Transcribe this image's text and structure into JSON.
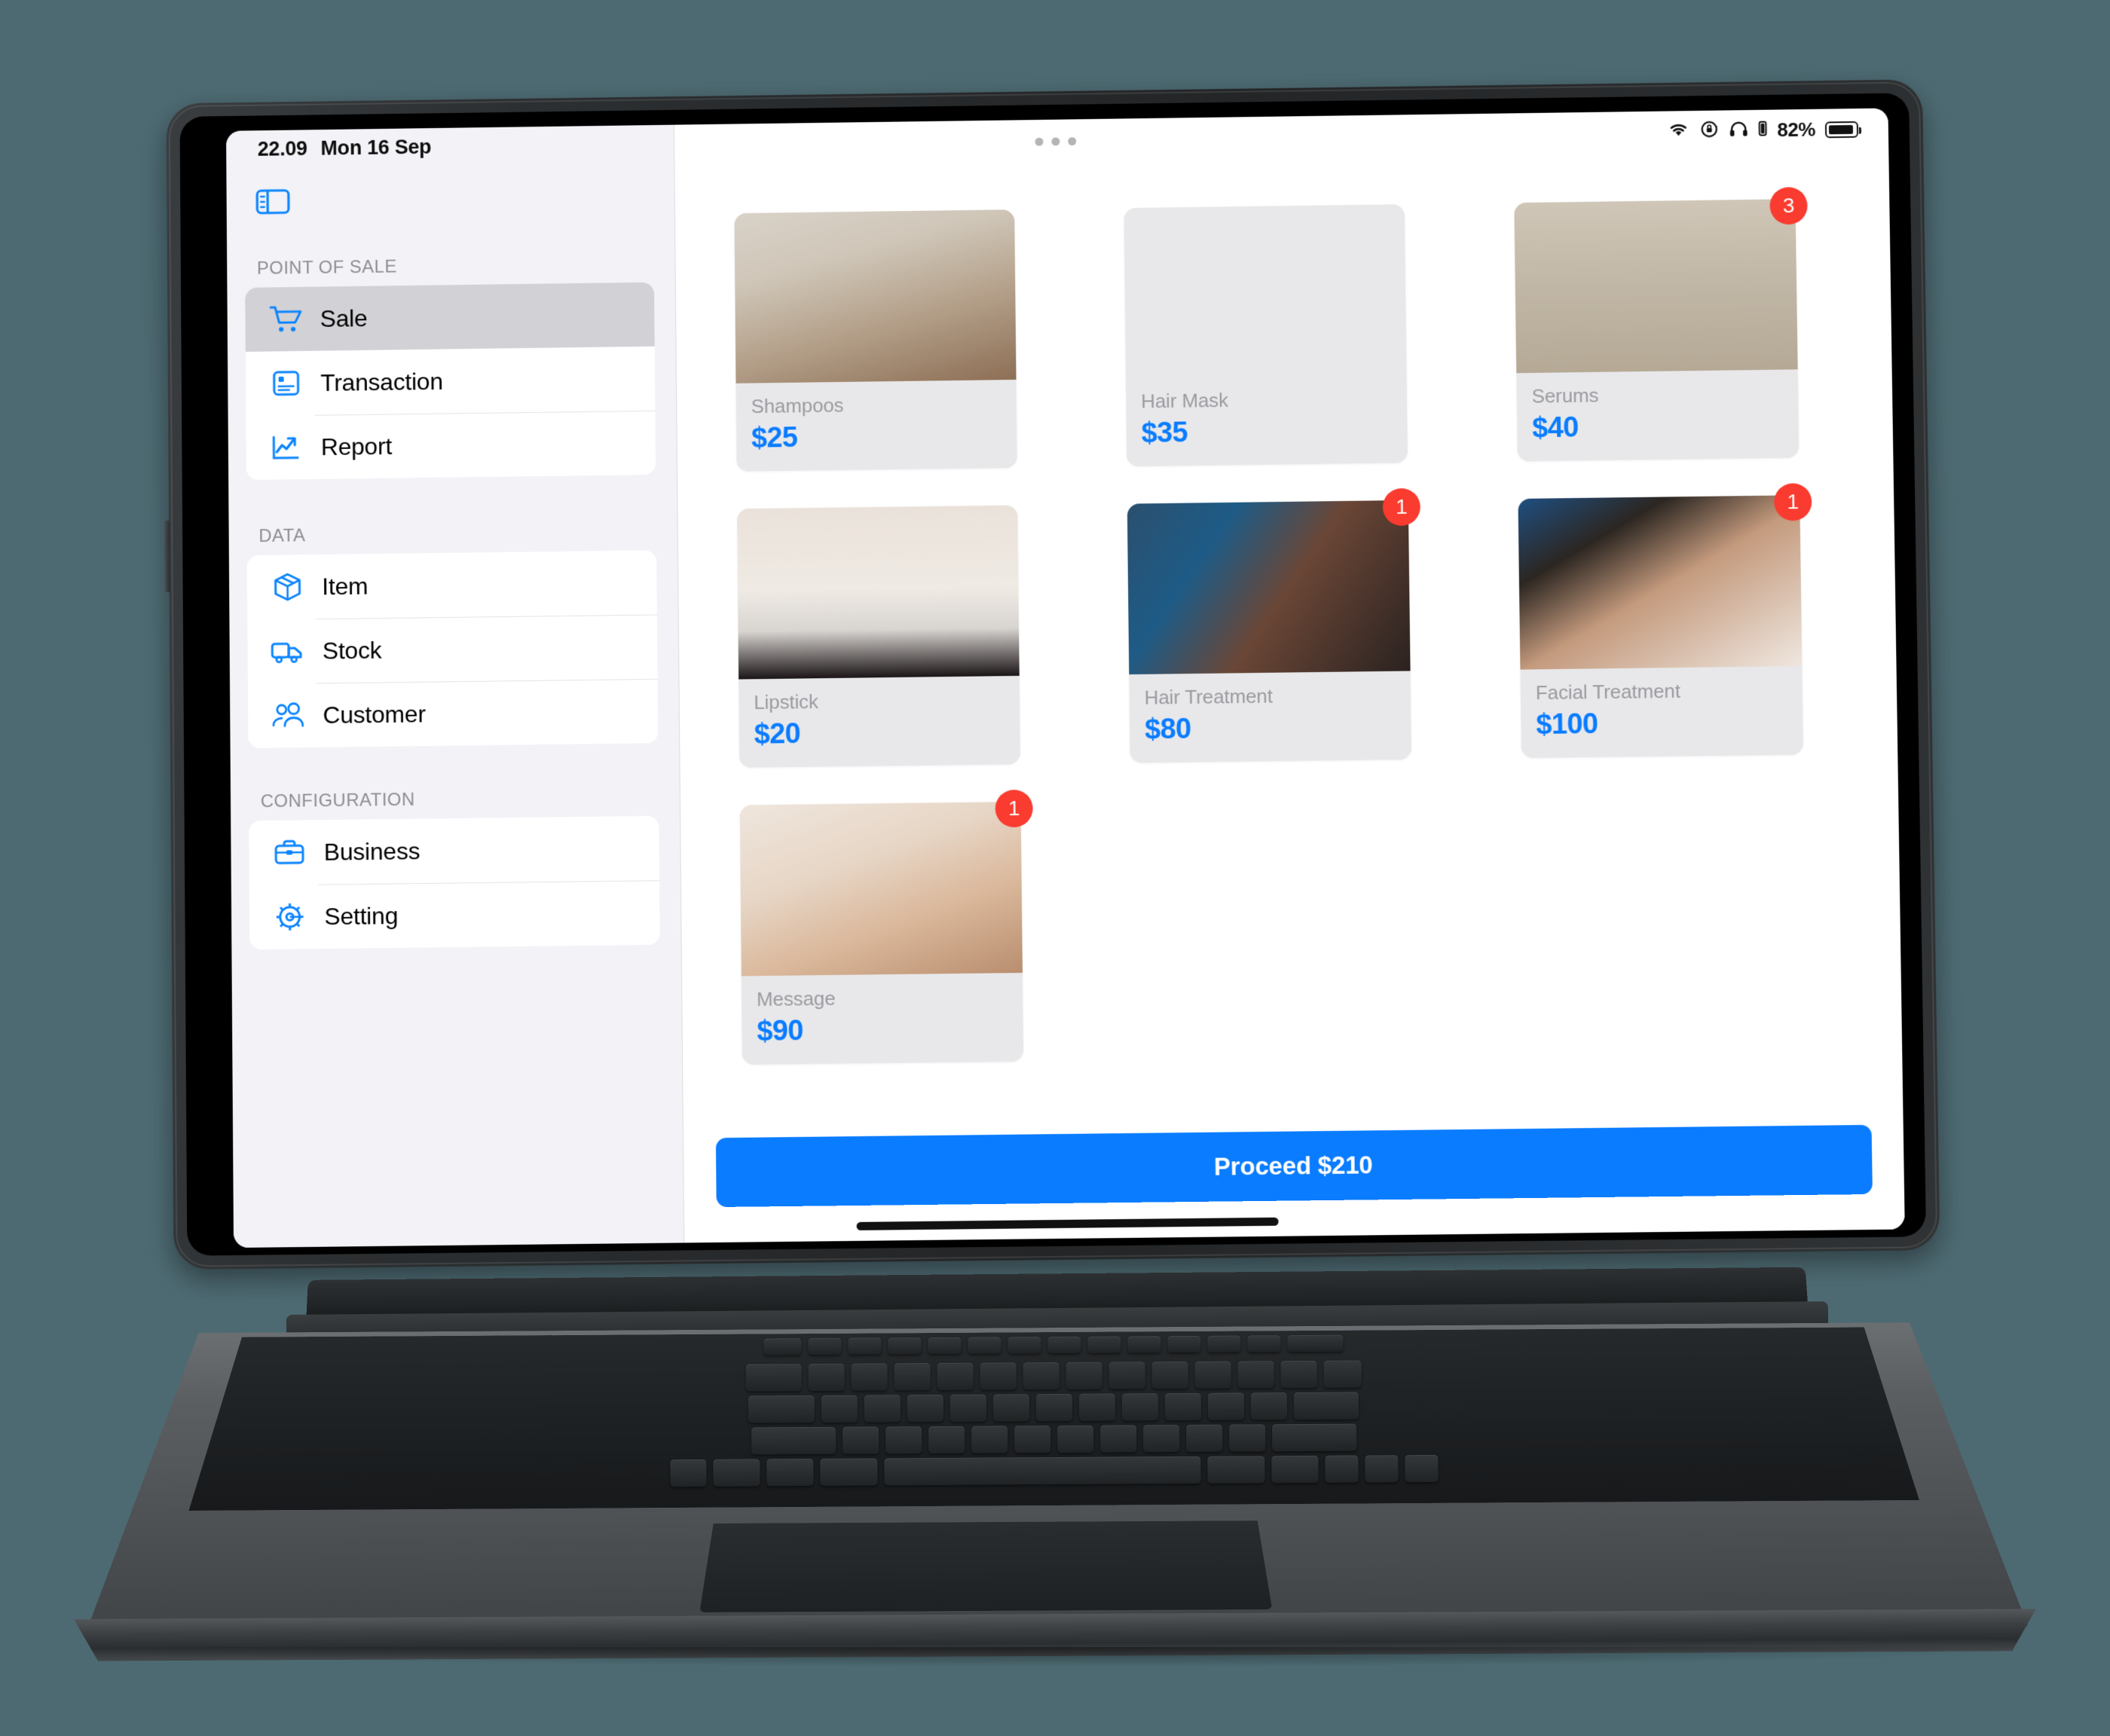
{
  "status_bar": {
    "time": "22.09",
    "date": "Mon 16 Sep",
    "battery_percent": "82%",
    "icons": [
      "wifi-icon",
      "rotation-lock-icon",
      "headphones-icon",
      "headphone-battery-icon",
      "battery-icon"
    ]
  },
  "multitask": {
    "name": "multitask-handle"
  },
  "sidebar": {
    "toggle_icon": "sidebar-toggle-icon",
    "sections": [
      {
        "title": "POINT OF SALE",
        "items": [
          {
            "label": "Sale",
            "icon": "cart-icon",
            "active": true
          },
          {
            "label": "Transaction",
            "icon": "receipt-icon",
            "active": false
          },
          {
            "label": "Report",
            "icon": "chart-line-up-icon",
            "active": false
          }
        ]
      },
      {
        "title": "DATA",
        "items": [
          {
            "label": "Item",
            "icon": "box-icon",
            "active": false
          },
          {
            "label": "Stock",
            "icon": "truck-icon",
            "active": false
          },
          {
            "label": "Customer",
            "icon": "people-icon",
            "active": false
          }
        ]
      },
      {
        "title": "CONFIGURATION",
        "items": [
          {
            "label": "Business",
            "icon": "briefcase-icon",
            "active": false
          },
          {
            "label": "Setting",
            "icon": "gear-icon",
            "active": false
          }
        ]
      }
    ]
  },
  "catalog": {
    "products": [
      {
        "name": "Shampoos",
        "price": "$25",
        "badge": null,
        "image": "shampoo-bottles-photo"
      },
      {
        "name": "Hair Mask",
        "price": "$35",
        "badge": null,
        "image": "hair-mask-bottles-photo"
      },
      {
        "name": "Serums",
        "price": "$40",
        "badge": "3",
        "image": "serum-dropper-bottle-photo"
      },
      {
        "name": "Lipstick",
        "price": "$20",
        "badge": null,
        "image": "lipsticks-row-photo"
      },
      {
        "name": "Hair Treatment",
        "price": "$80",
        "badge": "1",
        "image": "hair-blowdry-photo"
      },
      {
        "name": "Facial Treatment",
        "price": "$100",
        "badge": "1",
        "image": "facial-mask-photo"
      },
      {
        "name": "Message",
        "price": "$90",
        "badge": "1",
        "image": "massage-photo"
      }
    ]
  },
  "footer": {
    "proceed_label": "Proceed $210"
  },
  "colors": {
    "accent_blue": "#0a7cff",
    "badge_red": "#fa3b2f",
    "sidebar_bg": "#f2f2f7",
    "card_bg": "#e8e8ea",
    "page_bg": "#4d6a72"
  }
}
